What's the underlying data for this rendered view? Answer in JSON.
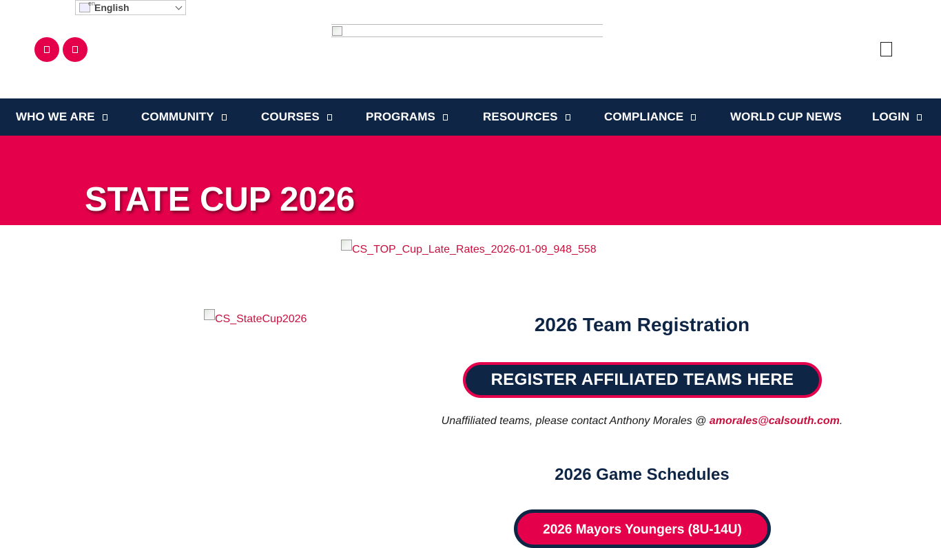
{
  "language": {
    "flag_alt": "en",
    "label": "English"
  },
  "social": [
    {
      "icon": "facebook-icon"
    },
    {
      "icon": "instagram-icon"
    }
  ],
  "nav": {
    "items": [
      {
        "label": "WHO WE ARE",
        "has_dropdown": true
      },
      {
        "label": "COMMUNITY",
        "has_dropdown": true
      },
      {
        "label": "COURSES",
        "has_dropdown": true
      },
      {
        "label": "PROGRAMS",
        "has_dropdown": true
      },
      {
        "label": "RESOURCES",
        "has_dropdown": true
      },
      {
        "label": "COMPLIANCE",
        "has_dropdown": true
      },
      {
        "label": "WORLD CUP NEWS",
        "has_dropdown": false
      },
      {
        "label": "LOGIN",
        "has_dropdown": true
      }
    ]
  },
  "banner": {
    "title": "STATE CUP 2026"
  },
  "top_image": {
    "alt": "CS_TOP_Cup_Late_Rates_2026-01-09_948_558"
  },
  "side_image": {
    "alt": "CS_StateCup2026"
  },
  "registration": {
    "heading": "2026 Team Registration",
    "button": "REGISTER AFFILIATED TEAMS HERE",
    "note_prefix": "Unaffiliated teams, please contact Anthony Morales @ ",
    "email": "amorales@calsouth.com",
    "note_suffix": "."
  },
  "schedules": {
    "heading": "2026 Game Schedules",
    "button": "2026 Mayors Youngers (8U-14U)"
  },
  "colors": {
    "navy": "#0e2545",
    "red": "#e4004b",
    "link": "#c8103e"
  }
}
